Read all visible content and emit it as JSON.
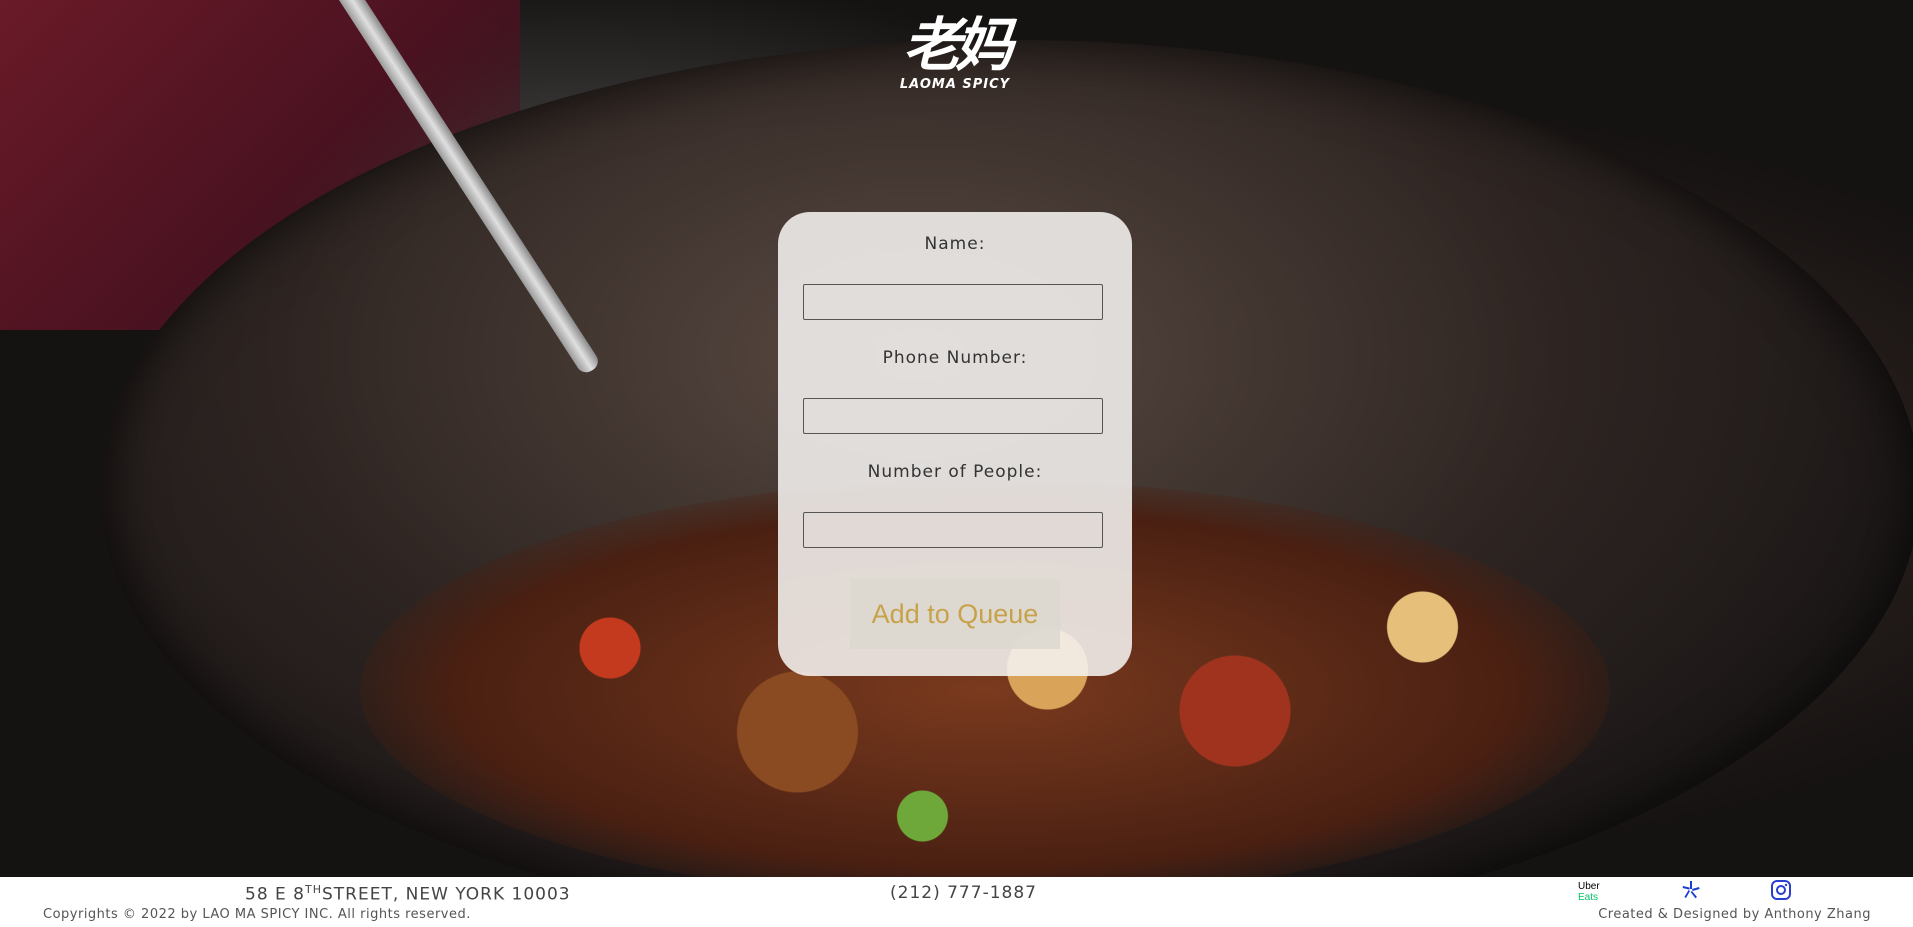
{
  "brand": {
    "logo_mark": "老妈",
    "logo_text": "LAOMA SPICY"
  },
  "form": {
    "name_label": "Name:",
    "name_value": "",
    "phone_label": "Phone Number:",
    "phone_value": "",
    "people_label": "Number of People:",
    "people_value": "",
    "submit_label": "Add to Queue"
  },
  "footer": {
    "address_number": "58 E 8",
    "address_suffix": "TH",
    "address_rest": "STREET, NEW YORK 10003",
    "phone": "(212) 777-1887",
    "copyright": "Copyrights © 2022 by LAO MA SPICY INC. All rights reserved.",
    "credits": "Created & Designed by Anthony Zhang",
    "uber_line1": "Uber",
    "uber_line2": "Eats",
    "social_icons": [
      "uber-eats-icon",
      "yelp-icon",
      "instagram-icon"
    ]
  },
  "colors": {
    "button_text": "#c8a24a",
    "uber_green": "#06c167",
    "yelp_blue": "#1a3fcf",
    "instagram_blue": "#2a3fcf"
  }
}
